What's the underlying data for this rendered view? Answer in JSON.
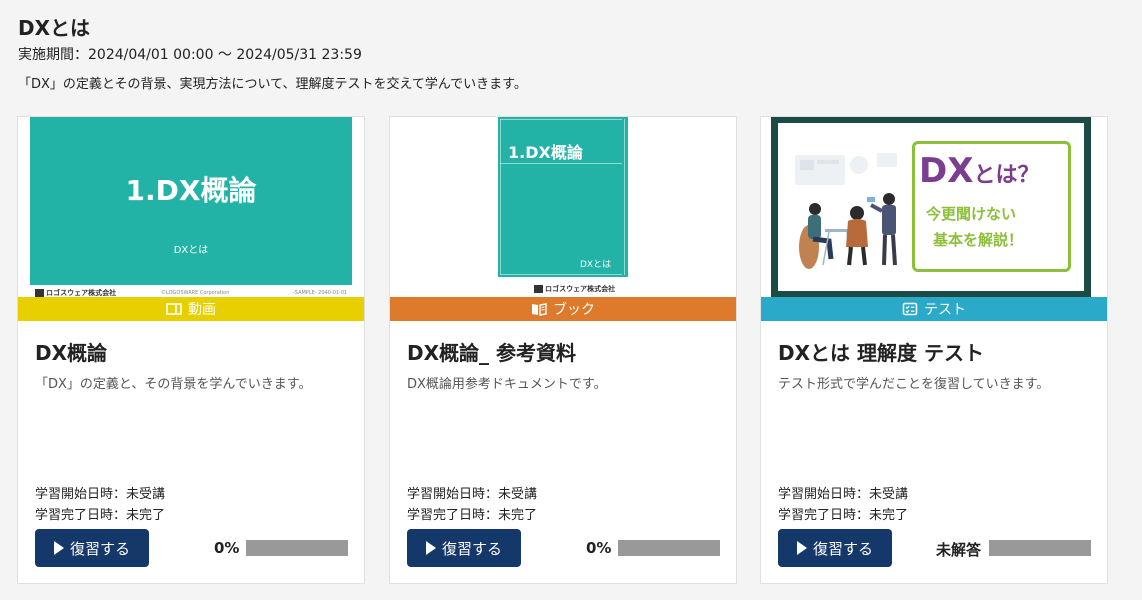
{
  "header": {
    "title": "DXとは",
    "period": "実施期間：2024/04/01 00:00 〜 2024/05/31 23:59",
    "description": "「DX」の定義とその背景、実現方法について、理解度テストを交えて学んでいきます。"
  },
  "colors": {
    "video": "#e7cf00",
    "book": "#dd7a2b",
    "test": "#2aa9c9",
    "button": "#15386b",
    "teal": "#22b2a6"
  },
  "cards": [
    {
      "type": "動画",
      "type_icon": "video-icon",
      "title": "DX概論",
      "description": "「DX」の定義と、その背景を学んでいきます。",
      "start": "学習開始日時：未受講",
      "end": "学習完了日時：未完了",
      "button": "復習する",
      "progress_label": "0%",
      "progress": 0,
      "thumb": {
        "title": "1.DX概論",
        "sub": "DXとは",
        "logo": "ロゴスウェア株式会社",
        "copyright": "©LOGOSWARE Corporation",
        "code": "-SAMPLE- 2040-01-01"
      }
    },
    {
      "type": "ブック",
      "type_icon": "book-icon",
      "title": "DX概論_ 参考資料",
      "description": "DX概論用参考ドキュメントです。",
      "start": "学習開始日時：未受講",
      "end": "学習完了日時：未完了",
      "button": "復習する",
      "progress_label": "0%",
      "progress": 0,
      "thumb": {
        "title": "1.DX概論",
        "sub": "DXとは",
        "logo": "ロゴスウェア株式会社"
      }
    },
    {
      "type": "テスト",
      "type_icon": "checklist-icon",
      "title": "DXとは 理解度 テスト",
      "description": "テスト形式で学んだことを復習していきます。",
      "start": "学習開始日時：未受講",
      "end": "学習完了日時：未完了",
      "button": "復習する",
      "progress_label": "未解答",
      "progress": 0,
      "thumb": {
        "dx": "DX",
        "dx_rest": "とは？",
        "line2": "今更聞けない",
        "line3": "基本を解説！"
      }
    }
  ]
}
